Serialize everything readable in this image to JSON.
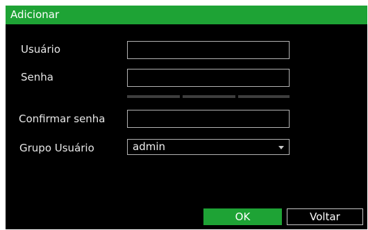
{
  "dialog": {
    "title": "Adicionar"
  },
  "form": {
    "user_label": "Usuário",
    "user_value": "",
    "password_label": "Senha",
    "password_value": "",
    "confirm_label": "Confirmar senha",
    "confirm_value": "",
    "group_label": "Grupo Usuário",
    "group_selected": "admin"
  },
  "buttons": {
    "ok": "OK",
    "back": "Voltar"
  },
  "colors": {
    "accent": "#1ea335",
    "background": "#000000",
    "field_border": "#b4b4b4",
    "strength_bar": "#3e3e3e"
  },
  "icons": {
    "dropdown": "chevron-down-icon"
  }
}
